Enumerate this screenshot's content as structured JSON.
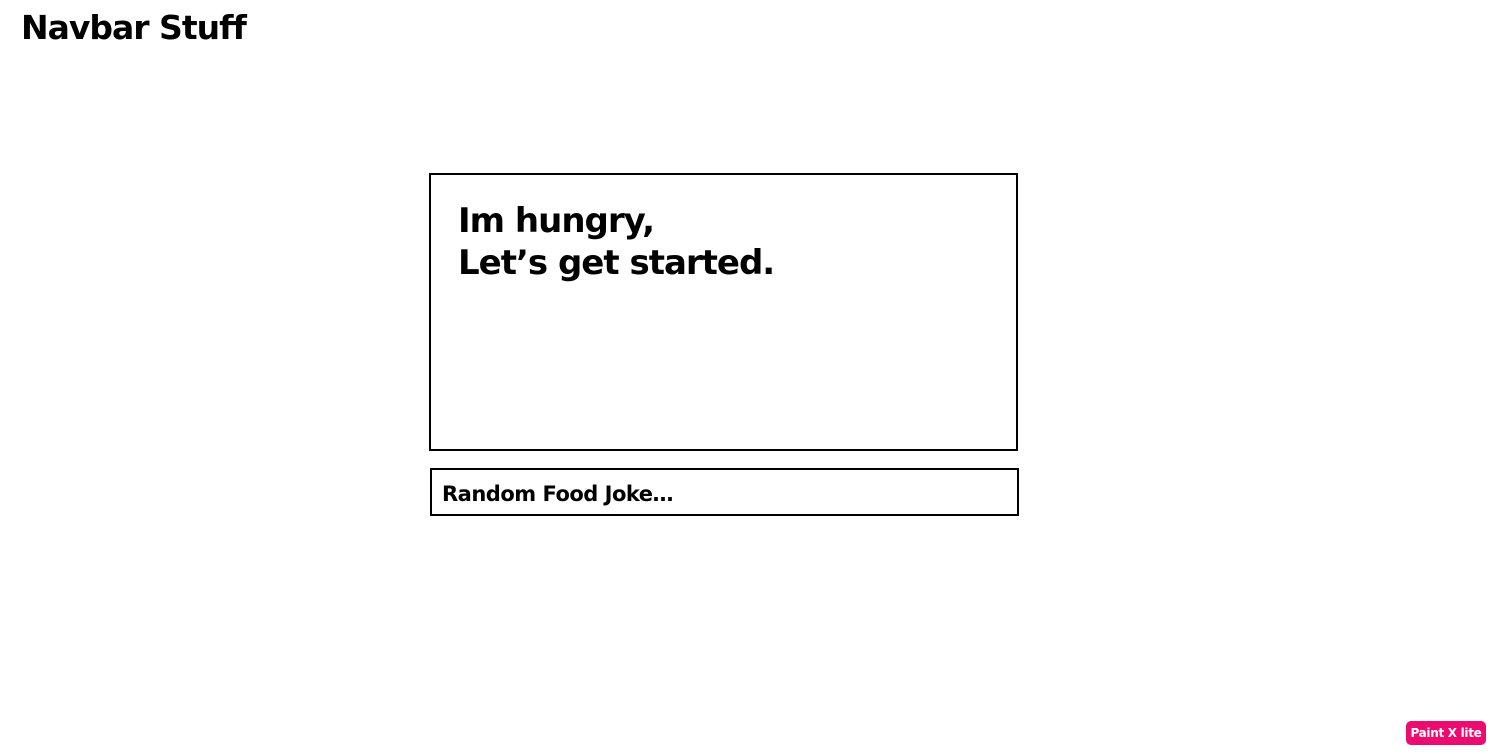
{
  "navbar": {
    "title": "Navbar Stuff"
  },
  "hero": {
    "line1": "Im hungry,",
    "line2": "Let’s get started."
  },
  "joke": {
    "text": "Random Food Joke…"
  },
  "badge": {
    "label": "Paint X lite",
    "color": "#ec0b6e"
  }
}
